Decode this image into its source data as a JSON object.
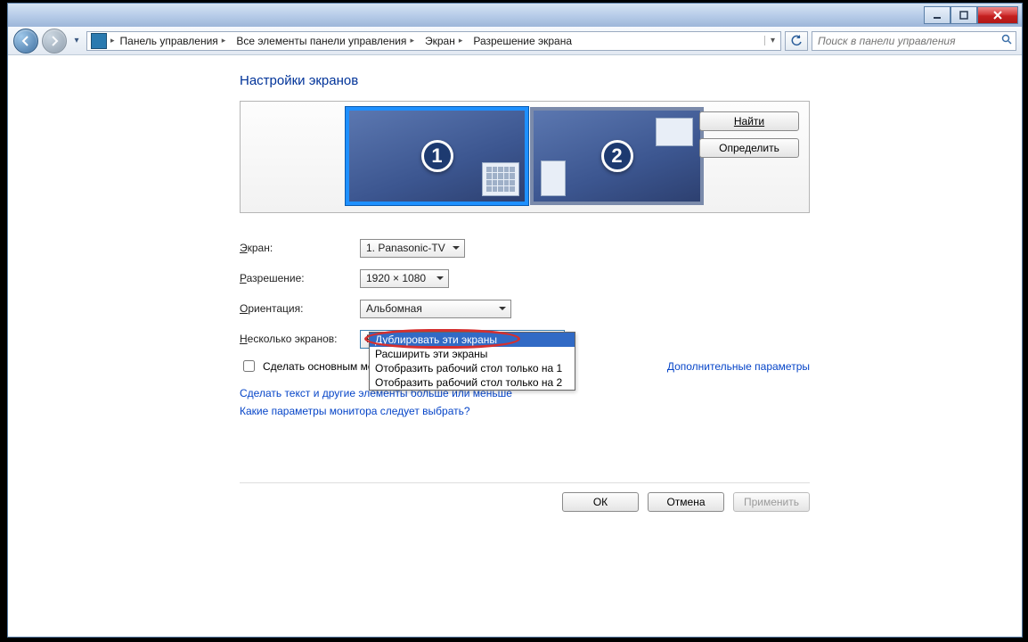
{
  "breadcrumbs": [
    "Панель управления",
    "Все элементы панели управления",
    "Экран",
    "Разрешение экрана"
  ],
  "search": {
    "placeholder": "Поиск в панели управления"
  },
  "page_title": "Настройки экранов",
  "side_buttons": {
    "find": "Найти",
    "detect": "Определить"
  },
  "displays": [
    {
      "number": "1"
    },
    {
      "number": "2"
    }
  ],
  "labels": {
    "display": "Экран:",
    "resolution": "Разрешение:",
    "orientation": "Ориентация:",
    "multiple": "Несколько экранов:",
    "make_main": "Сделать основным монитором",
    "advanced": "Дополнительные параметры"
  },
  "values": {
    "display": "1. Panasonic-TV",
    "resolution": "1920 × 1080",
    "orientation": "Альбомная",
    "multiple": "Расширить эти экраны"
  },
  "dropdown_options": [
    "Дублировать эти экраны",
    "Расширить эти экраны",
    "Отобразить рабочий стол только на 1",
    "Отобразить рабочий стол только на 2"
  ],
  "links": {
    "text_size": "Сделать текст и другие элементы больше или меньше",
    "which_settings": "Какие параметры монитора следует выбрать?"
  },
  "buttons": {
    "ok": "ОК",
    "cancel": "Отмена",
    "apply": "Применить"
  }
}
